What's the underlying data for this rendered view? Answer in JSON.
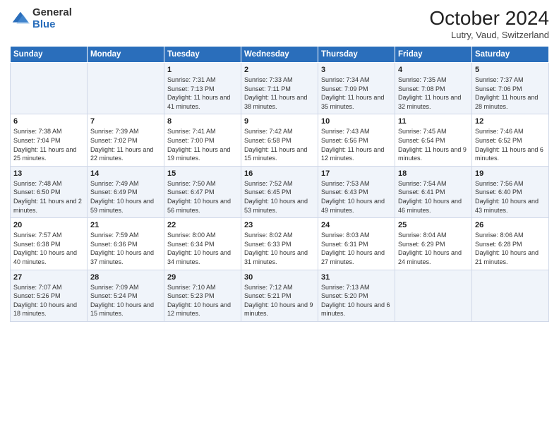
{
  "header": {
    "logo_general": "General",
    "logo_blue": "Blue",
    "title": "October 2024",
    "subtitle": "Lutry, Vaud, Switzerland"
  },
  "days_header": [
    "Sunday",
    "Monday",
    "Tuesday",
    "Wednesday",
    "Thursday",
    "Friday",
    "Saturday"
  ],
  "weeks": [
    [
      {
        "day": "",
        "content": ""
      },
      {
        "day": "",
        "content": ""
      },
      {
        "day": "1",
        "content": "Sunrise: 7:31 AM\nSunset: 7:13 PM\nDaylight: 11 hours and 41 minutes."
      },
      {
        "day": "2",
        "content": "Sunrise: 7:33 AM\nSunset: 7:11 PM\nDaylight: 11 hours and 38 minutes."
      },
      {
        "day": "3",
        "content": "Sunrise: 7:34 AM\nSunset: 7:09 PM\nDaylight: 11 hours and 35 minutes."
      },
      {
        "day": "4",
        "content": "Sunrise: 7:35 AM\nSunset: 7:08 PM\nDaylight: 11 hours and 32 minutes."
      },
      {
        "day": "5",
        "content": "Sunrise: 7:37 AM\nSunset: 7:06 PM\nDaylight: 11 hours and 28 minutes."
      }
    ],
    [
      {
        "day": "6",
        "content": "Sunrise: 7:38 AM\nSunset: 7:04 PM\nDaylight: 11 hours and 25 minutes."
      },
      {
        "day": "7",
        "content": "Sunrise: 7:39 AM\nSunset: 7:02 PM\nDaylight: 11 hours and 22 minutes."
      },
      {
        "day": "8",
        "content": "Sunrise: 7:41 AM\nSunset: 7:00 PM\nDaylight: 11 hours and 19 minutes."
      },
      {
        "day": "9",
        "content": "Sunrise: 7:42 AM\nSunset: 6:58 PM\nDaylight: 11 hours and 15 minutes."
      },
      {
        "day": "10",
        "content": "Sunrise: 7:43 AM\nSunset: 6:56 PM\nDaylight: 11 hours and 12 minutes."
      },
      {
        "day": "11",
        "content": "Sunrise: 7:45 AM\nSunset: 6:54 PM\nDaylight: 11 hours and 9 minutes."
      },
      {
        "day": "12",
        "content": "Sunrise: 7:46 AM\nSunset: 6:52 PM\nDaylight: 11 hours and 6 minutes."
      }
    ],
    [
      {
        "day": "13",
        "content": "Sunrise: 7:48 AM\nSunset: 6:50 PM\nDaylight: 11 hours and 2 minutes."
      },
      {
        "day": "14",
        "content": "Sunrise: 7:49 AM\nSunset: 6:49 PM\nDaylight: 10 hours and 59 minutes."
      },
      {
        "day": "15",
        "content": "Sunrise: 7:50 AM\nSunset: 6:47 PM\nDaylight: 10 hours and 56 minutes."
      },
      {
        "day": "16",
        "content": "Sunrise: 7:52 AM\nSunset: 6:45 PM\nDaylight: 10 hours and 53 minutes."
      },
      {
        "day": "17",
        "content": "Sunrise: 7:53 AM\nSunset: 6:43 PM\nDaylight: 10 hours and 49 minutes."
      },
      {
        "day": "18",
        "content": "Sunrise: 7:54 AM\nSunset: 6:41 PM\nDaylight: 10 hours and 46 minutes."
      },
      {
        "day": "19",
        "content": "Sunrise: 7:56 AM\nSunset: 6:40 PM\nDaylight: 10 hours and 43 minutes."
      }
    ],
    [
      {
        "day": "20",
        "content": "Sunrise: 7:57 AM\nSunset: 6:38 PM\nDaylight: 10 hours and 40 minutes."
      },
      {
        "day": "21",
        "content": "Sunrise: 7:59 AM\nSunset: 6:36 PM\nDaylight: 10 hours and 37 minutes."
      },
      {
        "day": "22",
        "content": "Sunrise: 8:00 AM\nSunset: 6:34 PM\nDaylight: 10 hours and 34 minutes."
      },
      {
        "day": "23",
        "content": "Sunrise: 8:02 AM\nSunset: 6:33 PM\nDaylight: 10 hours and 31 minutes."
      },
      {
        "day": "24",
        "content": "Sunrise: 8:03 AM\nSunset: 6:31 PM\nDaylight: 10 hours and 27 minutes."
      },
      {
        "day": "25",
        "content": "Sunrise: 8:04 AM\nSunset: 6:29 PM\nDaylight: 10 hours and 24 minutes."
      },
      {
        "day": "26",
        "content": "Sunrise: 8:06 AM\nSunset: 6:28 PM\nDaylight: 10 hours and 21 minutes."
      }
    ],
    [
      {
        "day": "27",
        "content": "Sunrise: 7:07 AM\nSunset: 5:26 PM\nDaylight: 10 hours and 18 minutes."
      },
      {
        "day": "28",
        "content": "Sunrise: 7:09 AM\nSunset: 5:24 PM\nDaylight: 10 hours and 15 minutes."
      },
      {
        "day": "29",
        "content": "Sunrise: 7:10 AM\nSunset: 5:23 PM\nDaylight: 10 hours and 12 minutes."
      },
      {
        "day": "30",
        "content": "Sunrise: 7:12 AM\nSunset: 5:21 PM\nDaylight: 10 hours and 9 minutes."
      },
      {
        "day": "31",
        "content": "Sunrise: 7:13 AM\nSunset: 5:20 PM\nDaylight: 10 hours and 6 minutes."
      },
      {
        "day": "",
        "content": ""
      },
      {
        "day": "",
        "content": ""
      }
    ]
  ]
}
